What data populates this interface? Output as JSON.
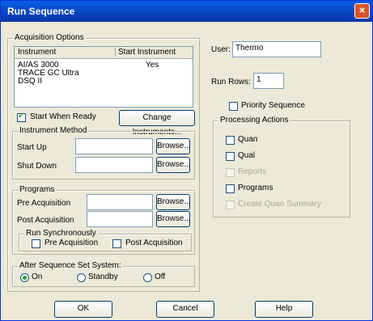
{
  "window": {
    "title": "Run Sequence",
    "close_glyph": "×"
  },
  "acquisition": {
    "group_label": "Acquisition Options",
    "columns": [
      "Instrument",
      "Start Instrument"
    ],
    "rows": [
      {
        "instrument": "AI/AS 3000",
        "start": "Yes"
      },
      {
        "instrument": "TRACE GC Ultra",
        "start": ""
      },
      {
        "instrument": "DSQ II",
        "start": ""
      }
    ],
    "start_when_ready": {
      "label": "Start When Ready",
      "checked": true
    },
    "change_instruments": "Change Instruments..."
  },
  "instrument_method": {
    "group_label": "Instrument Method",
    "start_up": {
      "label": "Start Up",
      "value": "",
      "browse": "Browse..."
    },
    "shut_down": {
      "label": "Shut Down",
      "value": "",
      "browse": "Browse..."
    }
  },
  "programs": {
    "group_label": "Programs",
    "pre": {
      "label": "Pre Acquisition",
      "value": "",
      "browse": "Browse..."
    },
    "post": {
      "label": "Post Acquisition",
      "value": "",
      "browse": "Browse..."
    },
    "run_sync": {
      "group_label": "Run Synchronously",
      "pre": "Pre Acquisition",
      "post": "Post Acquisition"
    }
  },
  "after_sequence": {
    "group_label": "After Sequence Set System:",
    "options": [
      "On",
      "Standby",
      "Off"
    ],
    "selected": "On"
  },
  "user": {
    "label": "User:",
    "value": "Thermo"
  },
  "run_rows": {
    "label": "Run Rows:",
    "value": "1"
  },
  "priority_sequence": {
    "label": "Priority Sequence",
    "checked": false
  },
  "processing": {
    "group_label": "Processing Actions",
    "quan": "Quan",
    "qual": "Qual",
    "reports": "Reports",
    "programs": "Programs",
    "create_quan_summary": "Create Quan Summary"
  },
  "buttons": {
    "ok": "OK",
    "cancel": "Cancel",
    "help": "Help"
  }
}
